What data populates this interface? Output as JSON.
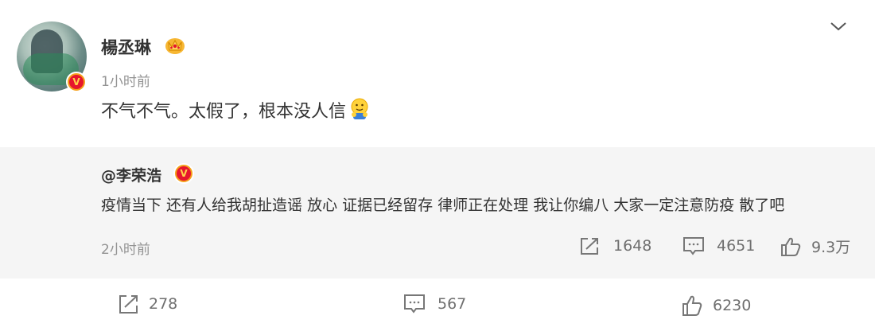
{
  "post": {
    "username": "楊丞琳",
    "time": "1小时前",
    "content": "不气不气。太假了，根本没人信"
  },
  "repost": {
    "username": "@李荣浩",
    "content": "疫情当下 还有人给我胡扯造谣 放心 证据已经留存 律师正在处理 我让你编八 大家一定注意防疫 散了吧",
    "time": "2小时前",
    "reposts": "1648",
    "comments": "4651",
    "likes": "9.3万"
  },
  "actions": {
    "reposts": "278",
    "comments": "567",
    "likes": "6230"
  },
  "icons": {
    "verified": "verified-v-icon",
    "crown": "crown-icon",
    "emoji": "hug-emoji",
    "menu": "chevron-down-icon",
    "repost": "repost-icon",
    "comment": "comment-icon",
    "like": "thumbs-up-icon"
  },
  "colors": {
    "verified_badge": "#e6162d",
    "badge_ring": "#f5a01a",
    "muted_text": "#939393",
    "repost_bg": "#f5f5f5"
  }
}
